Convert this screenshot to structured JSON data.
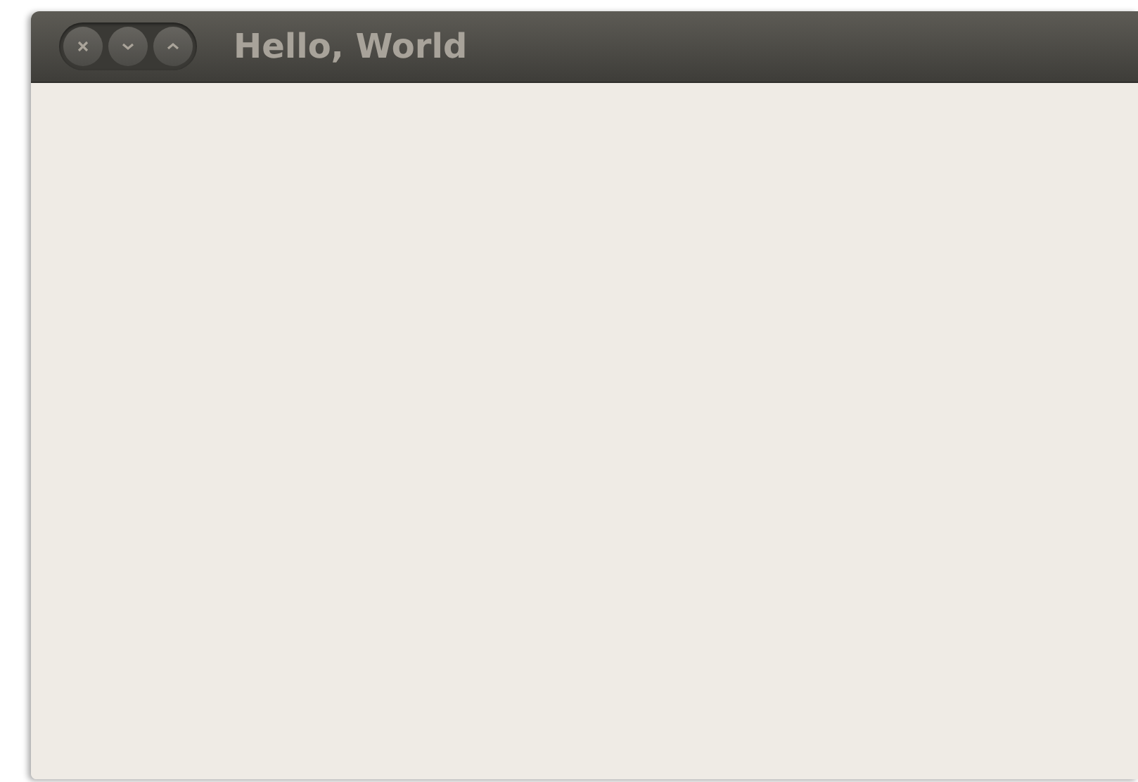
{
  "window": {
    "title": "Hello, World"
  }
}
